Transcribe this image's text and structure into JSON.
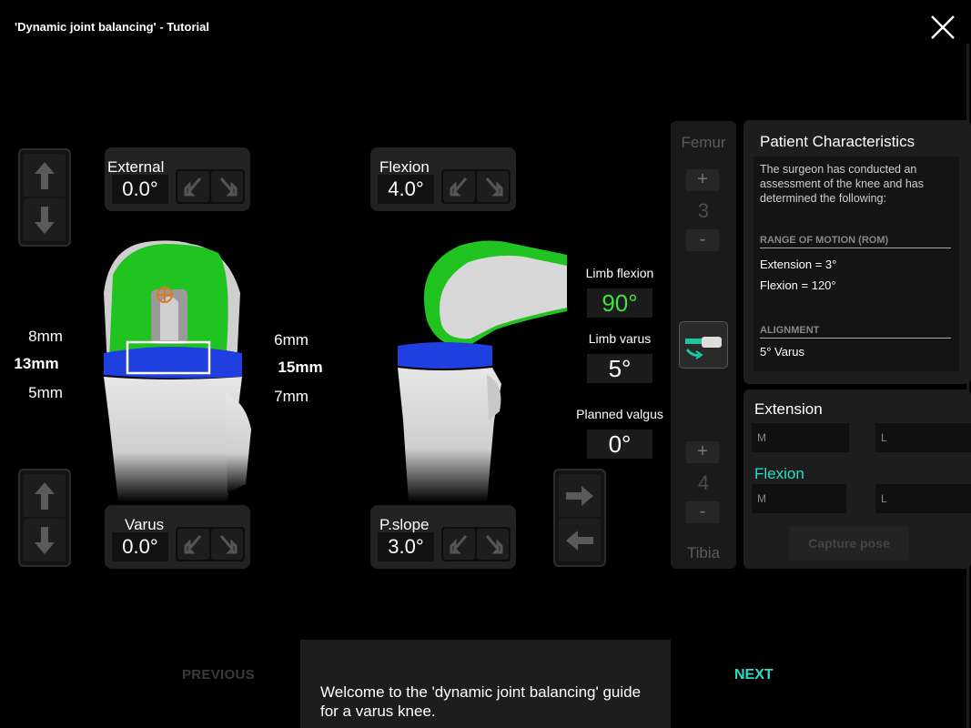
{
  "window": {
    "title": "'Dynamic joint balancing' - Tutorial",
    "close_icon": "close-icon"
  },
  "controls": {
    "external": {
      "label": "External",
      "value": "0.0°"
    },
    "varus": {
      "label": "Varus",
      "value": "0.0°"
    },
    "flexion": {
      "label": "Flexion",
      "value": "4.0°"
    },
    "pslope": {
      "label": "P.slope",
      "value": "3.0°"
    }
  },
  "gaps_front": {
    "top": "8mm",
    "middle": "13mm",
    "bottom": "5mm"
  },
  "gaps_side": {
    "top": "6mm",
    "middle": "15mm",
    "bottom": "7mm"
  },
  "limb": {
    "flexion_label": "Limb flexion",
    "flexion_value": "90°",
    "varus_label": "Limb varus",
    "varus_value": "5°",
    "valgus_label": "Planned valgus",
    "valgus_value": "0°"
  },
  "femur": {
    "label": "Femur",
    "plus": "+",
    "value": "3",
    "minus": "-"
  },
  "tibia": {
    "label": "Tibia",
    "plus": "+",
    "value": "4",
    "minus": "-"
  },
  "patient": {
    "title": "Patient Characteristics",
    "intro": "The surgeon has conducted an assessment of the knee and has determined the following:",
    "rom_header": "RANGE OF MOTION (ROM)",
    "rom_extension": "Extension = 3°",
    "rom_flexion": "Flexion = 120°",
    "alignment_header": "ALIGNMENT",
    "alignment_value": "5° Varus"
  },
  "balance": {
    "extension_label": "Extension",
    "flexion_label": "Flexion",
    "m_placeholder": "M",
    "l_placeholder": "L",
    "capture_label": "Capture pose"
  },
  "nav": {
    "previous": "PREVIOUS",
    "next": "NEXT"
  },
  "tip": "Welcome to the 'dynamic joint balancing' guide for a varus knee.",
  "colors": {
    "accent": "#25e0c6",
    "implant_green": "#22cc22",
    "insert_blue": "#1f3fe0",
    "limb_flexion": "#3ee33e"
  }
}
